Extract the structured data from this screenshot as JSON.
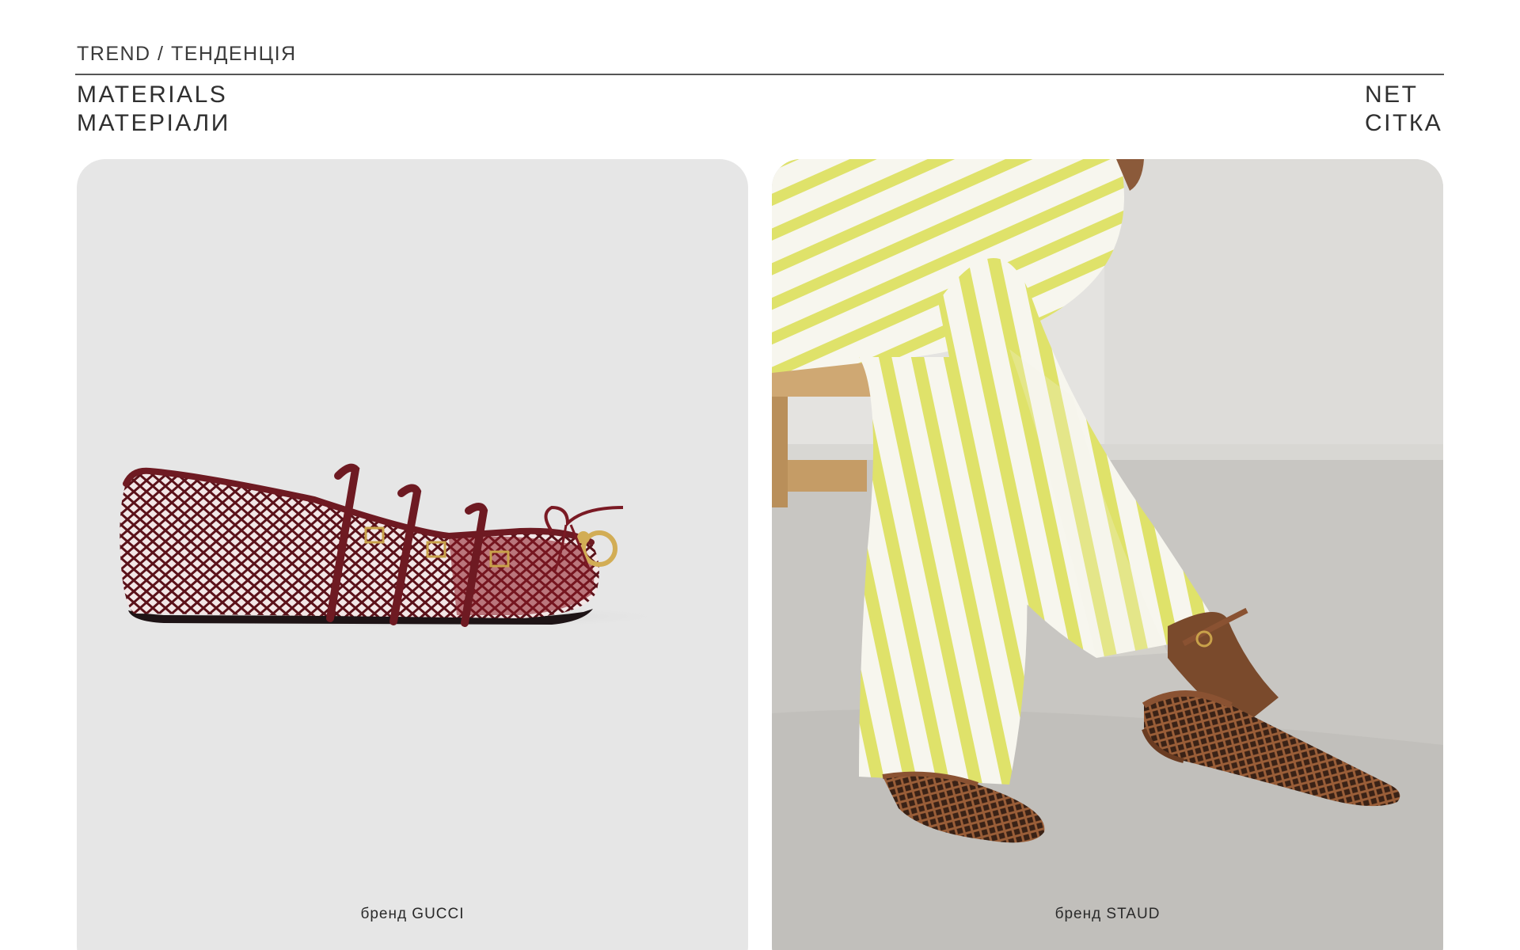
{
  "header": {
    "eyebrow": "TREND / ТЕНДЕНЦІЯ",
    "section_en": "MATERIALS",
    "section_uk": "МАТЕРІАЛИ",
    "topic_en": "NET",
    "topic_uk": "СІТКА"
  },
  "cards": [
    {
      "caption": "бренд GUCCI",
      "image": "burgundy-mesh-ballet-flat-photo",
      "colors": {
        "background": "#e6e6e6",
        "shoe": "#6e1a22",
        "hardware": "#c9a24a"
      }
    },
    {
      "caption": "бренд STAUD",
      "image": "striped-trousers-woven-brown-mules-photo",
      "colors": {
        "wall": "#e4e3e0",
        "floor": "#c8c6c2",
        "stripe": "#dfe26a",
        "shoe": "#8a5232"
      }
    }
  ]
}
